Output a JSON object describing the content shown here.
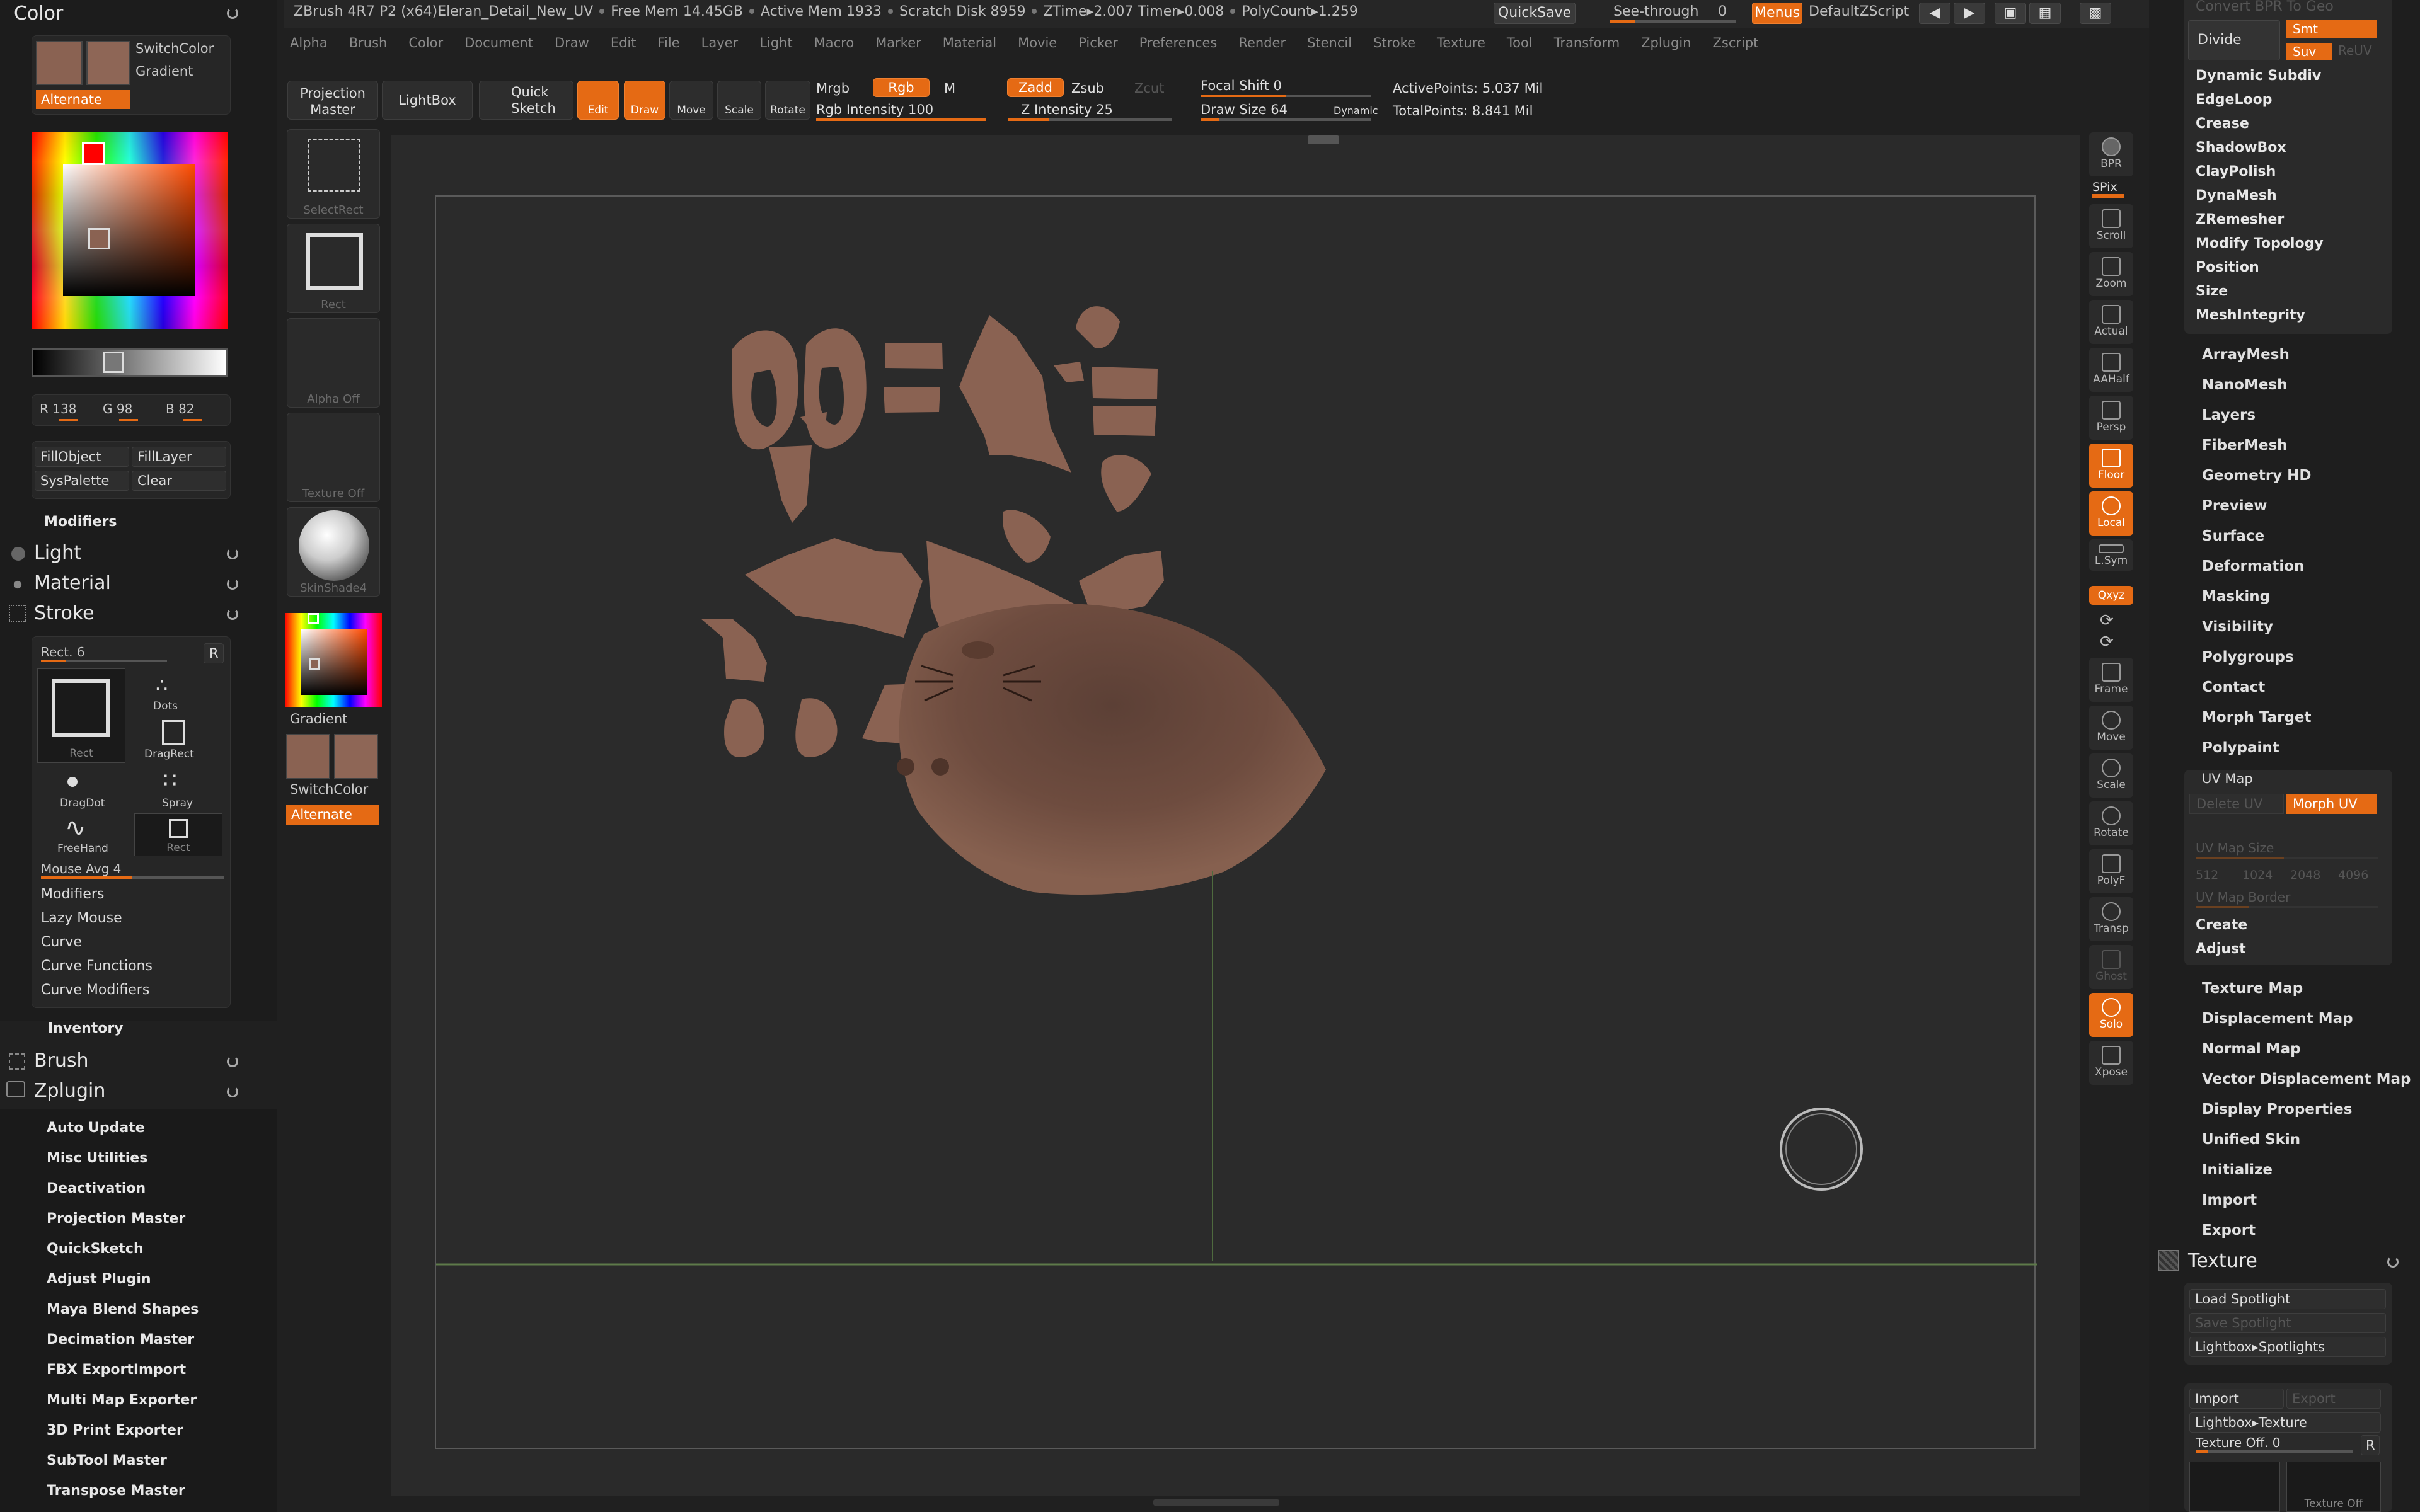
{
  "topbar": {
    "title": "ZBrush 4R7 P2 (x64)Eleran_Detail_New_UV",
    "free_mem": "Free Mem 14.45GB",
    "active_mem": "Active Mem 1933",
    "scratch": "Scratch Disk 8959",
    "ztime": "ZTime▸2.007",
    "timer": "Timer▸0.008",
    "polycount": "PolyCount▸1.259",
    "quicksave": "QuickSave",
    "see_through": "See-through",
    "see_through_val": "0",
    "menus": "Menus",
    "script": "DefaultZScript"
  },
  "menubar": [
    "Alpha",
    "Brush",
    "Color",
    "Document",
    "Draw",
    "Edit",
    "File",
    "Layer",
    "Light",
    "Macro",
    "Marker",
    "Material",
    "Movie",
    "Picker",
    "Preferences",
    "Render",
    "Stencil",
    "Stroke",
    "Texture",
    "Tool",
    "Transform",
    "Zplugin",
    "Zscript"
  ],
  "shelf": {
    "projection_master": "Projection Master",
    "lightbox": "LightBox",
    "quick_sketch": "Quick Sketch",
    "edit": "Edit",
    "draw": "Draw",
    "move": "Move",
    "scale": "Scale",
    "rotate": "Rotate",
    "mrgb": "Mrgb",
    "rgb": "Rgb",
    "m": "M",
    "rgb_intensity": "Rgb Intensity 100",
    "zadd": "Zadd",
    "zsub": "Zsub",
    "zcut": "Zcut",
    "z_intensity": "Z Intensity 25",
    "focal_shift": "Focal Shift 0",
    "draw_size": "Draw Size 64",
    "dynamic": "Dynamic",
    "active_points": "ActivePoints: 5.037 Mil",
    "total_points": "TotalPoints: 8.841 Mil"
  },
  "left": {
    "color_title": "Color",
    "switch_color": "SwitchColor",
    "gradient": "Gradient",
    "alternate": "Alternate",
    "r": "R 138",
    "g": "G 98",
    "b": "B 82",
    "fill_object": "FillObject",
    "fill_layer": "FillLayer",
    "sys_palette": "SysPalette",
    "clear": "Clear",
    "modifiers": "Modifiers",
    "light": "Light",
    "material": "Material",
    "stroke": "Stroke",
    "rect_slider": "Rect. 6",
    "r_btn": "R",
    "strokes": [
      "Rect",
      "Dots",
      "DragRect",
      "DragDot",
      "Spray",
      "FreeHand",
      "Rect"
    ],
    "mouse_avg": "Mouse Avg 4",
    "stroke_sub": [
      "Modifiers",
      "Lazy Mouse",
      "Curve",
      "Curve Functions",
      "Curve Modifiers"
    ],
    "inventory": "Inventory",
    "brush": "Brush",
    "zplugin": "Zplugin",
    "plugins": [
      "Auto Update",
      "Misc Utilities",
      "Deactivation",
      "Projection Master",
      "QuickSketch",
      "Adjust Plugin",
      "Maya Blend Shapes",
      "Decimation Master",
      "FBX ExportImport",
      "Multi Map Exporter",
      "3D Print Exporter",
      "SubTool Master",
      "Transpose Master"
    ]
  },
  "shelfcol": {
    "select_rect": "SelectRect",
    "rect": "Rect",
    "alpha_off": "Alpha  Off",
    "texture_off": "Texture  Off",
    "material": "SkinShade4",
    "gradient": "Gradient",
    "switch_color": "SwitchColor",
    "alternate": "Alternate"
  },
  "rightshelf": [
    "BPR",
    "SPix",
    "Scroll",
    "Zoom",
    "Actual",
    "AAHalf",
    "Persp",
    "Floor",
    "Local",
    "L.Sym",
    "Qxyz",
    "Frame",
    "Move",
    "Scale",
    "Rotate",
    "PolyF",
    "Transp",
    "Ghost",
    "Solo",
    "Xpose"
  ],
  "right": {
    "convert_bpr": "Convert BPR To Geo",
    "divide": "Divide",
    "smt": "Smt",
    "suv": "Suv",
    "reuv": "ReUV",
    "items_a": [
      "Dynamic Subdiv",
      "EdgeLoop",
      "Crease",
      "ShadowBox",
      "ClayPolish",
      "DynaMesh",
      "ZRemesher",
      "Modify Topology",
      "Position",
      "Size",
      "MeshIntegrity"
    ],
    "items_b": [
      "ArrayMesh",
      "NanoMesh",
      "Layers",
      "FiberMesh",
      "Geometry HD",
      "Preview",
      "Surface",
      "Deformation",
      "Masking",
      "Visibility",
      "Polygroups",
      "Contact",
      "Morph Target",
      "Polypaint"
    ],
    "uv_map": "UV Map",
    "delete_uv": "Delete UV",
    "morph_uv": "Morph UV",
    "uv_map_size": "UV Map Size",
    "sizes": [
      "512",
      "1024",
      "2048",
      "4096"
    ],
    "uv_map_border": "UV Map Border",
    "create": "Create",
    "adjust": "Adjust",
    "items_c": [
      "Texture Map",
      "Displacement Map",
      "Normal Map",
      "Vector Displacement Map",
      "Display Properties",
      "Unified Skin",
      "Initialize",
      "Import",
      "Export"
    ],
    "texture_title": "Texture",
    "load_spotlight": "Load Spotlight",
    "save_spotlight": "Save Spotlight",
    "lightbox_spotlights": "Lightbox▸Spotlights",
    "import": "Import",
    "export": "Export",
    "lightbox_texture": "Lightbox▸Texture",
    "texture_off": "Texture Off. 0",
    "r": "R",
    "texture_off_cap": "Texture  Off"
  },
  "colors": {
    "skin": "#8a6252",
    "accent": "#e56a14",
    "bg": "#202020"
  }
}
